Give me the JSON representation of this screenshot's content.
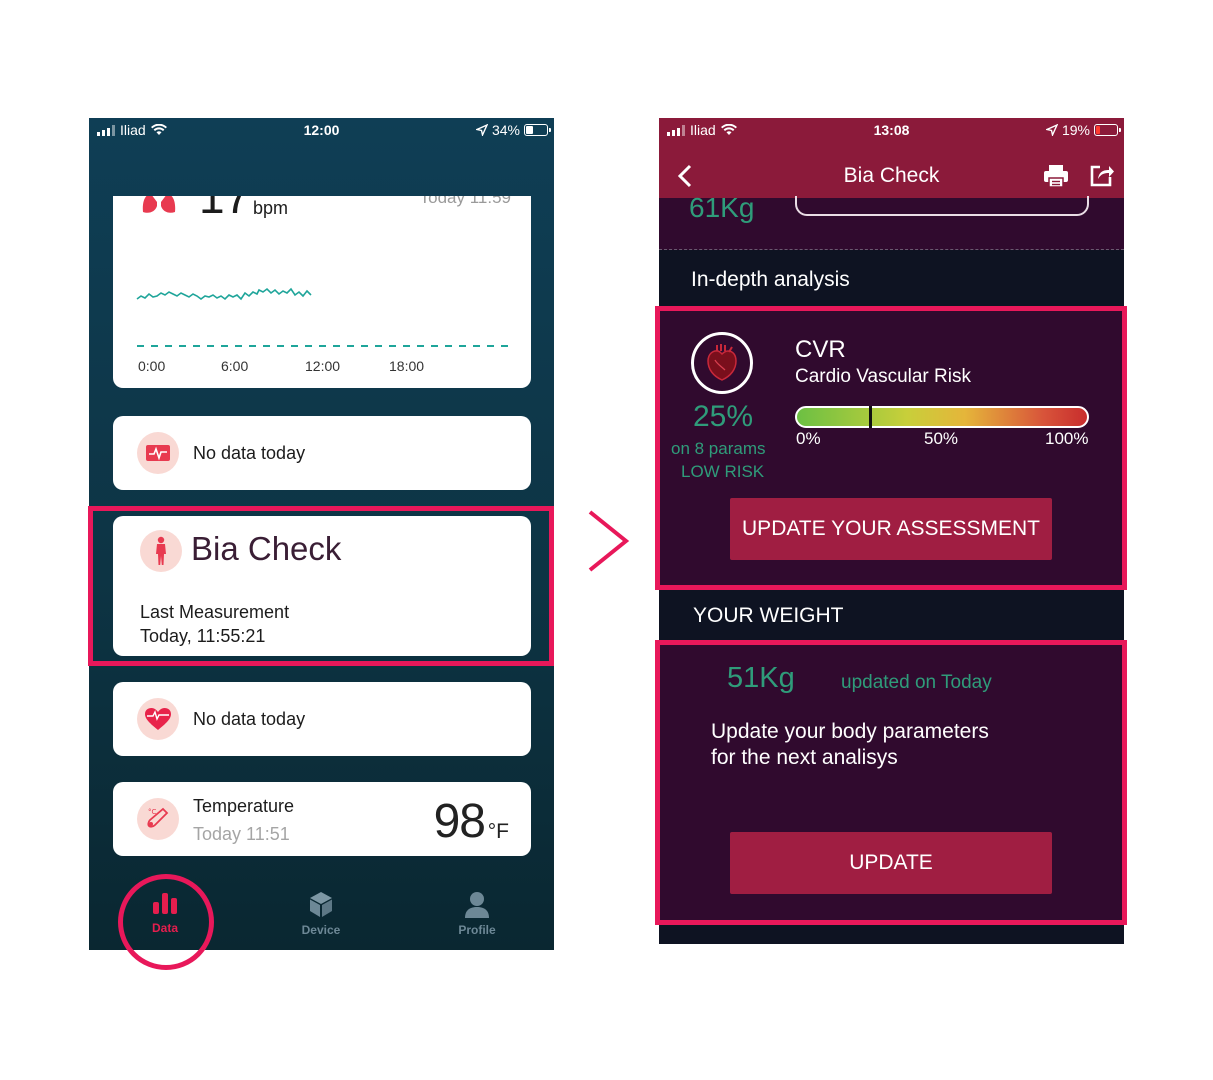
{
  "left": {
    "status": {
      "carrier": "Iliad",
      "time": "12:00",
      "battery": "34%"
    },
    "chart_card": {
      "value": "17",
      "unit": "bpm",
      "time": "Today 11:59",
      "x_ticks": [
        "0:00",
        "6:00",
        "12:00",
        "18:00"
      ]
    },
    "cards": {
      "nodata1": "No data today",
      "bia": {
        "title": "Bia Check",
        "last_label": "Last Measurement",
        "last_value": "Today, 11:55:21"
      },
      "nodata2": "No data today",
      "temperature": {
        "label": "Temperature",
        "time": "Today 11:51",
        "value": "98",
        "unit": "°F"
      }
    },
    "tabs": [
      {
        "label": "Data",
        "active": true
      },
      {
        "label": "Device",
        "active": false
      },
      {
        "label": "Profile",
        "active": false
      }
    ]
  },
  "right": {
    "status": {
      "carrier": "Iliad",
      "time": "13:08",
      "battery": "19%"
    },
    "header": {
      "title": "Bia Check"
    },
    "top_value": "61Kg",
    "sections": {
      "analysis_title": "In-depth analysis",
      "weight_title": "YOUR WEIGHT"
    },
    "cvr": {
      "title": "CVR",
      "subtitle": "Cardio Vascular Risk",
      "percent": "25%",
      "params": "on 8 params",
      "risk": "LOW RISK",
      "gauge_value": 0.25,
      "gauge_ticks": [
        "0%",
        "50%",
        "100%"
      ],
      "button": "UPDATE YOUR ASSESSMENT"
    },
    "weight": {
      "value": "51Kg",
      "updated": "updated on Today",
      "message_line1": "Update your body parameters",
      "message_line2": "for the next analisys",
      "button": "UPDATE"
    }
  },
  "colors": {
    "highlight": "#e8185a",
    "accent_green": "#2f9c7a",
    "header_maroon": "#8b1a3a",
    "panel_purple": "#300a2e",
    "button": "#a01e42"
  }
}
